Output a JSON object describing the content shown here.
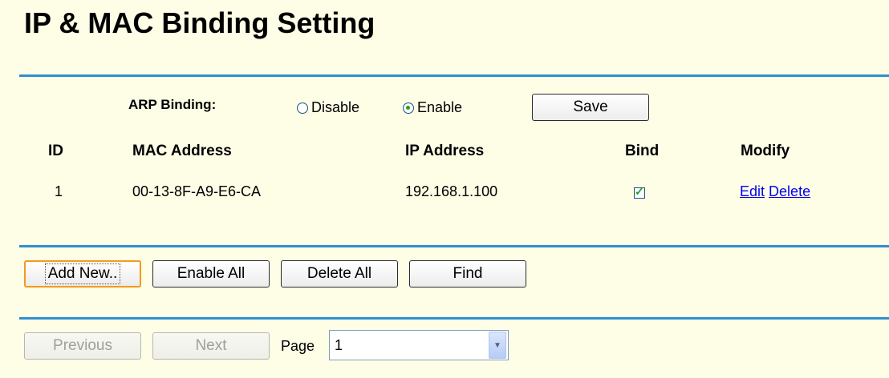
{
  "page": {
    "title": "IP & MAC Binding Setting"
  },
  "arp": {
    "label": "ARP Binding:",
    "options": [
      {
        "label": "Disable",
        "selected": false
      },
      {
        "label": "Enable",
        "selected": true
      }
    ],
    "save_label": "Save"
  },
  "table": {
    "headers": [
      "ID",
      "MAC Address",
      "IP Address",
      "Bind",
      "Modify"
    ],
    "rows": [
      {
        "id": "1",
        "mac": "00-13-8F-A9-E6-CA",
        "ip": "192.168.1.100",
        "bind": true,
        "edit_label": "Edit",
        "delete_label": "Delete"
      }
    ]
  },
  "actions": {
    "add_new": "Add New..",
    "enable_all": "Enable All",
    "delete_all": "Delete All",
    "find": "Find"
  },
  "pager": {
    "previous": "Previous",
    "next": "Next",
    "page_label": "Page",
    "page_value": "1"
  },
  "colors": {
    "background": "#fefee7",
    "rule": "#2f8fce",
    "link": "#0000ee",
    "focus_border": "#f29a1e"
  }
}
